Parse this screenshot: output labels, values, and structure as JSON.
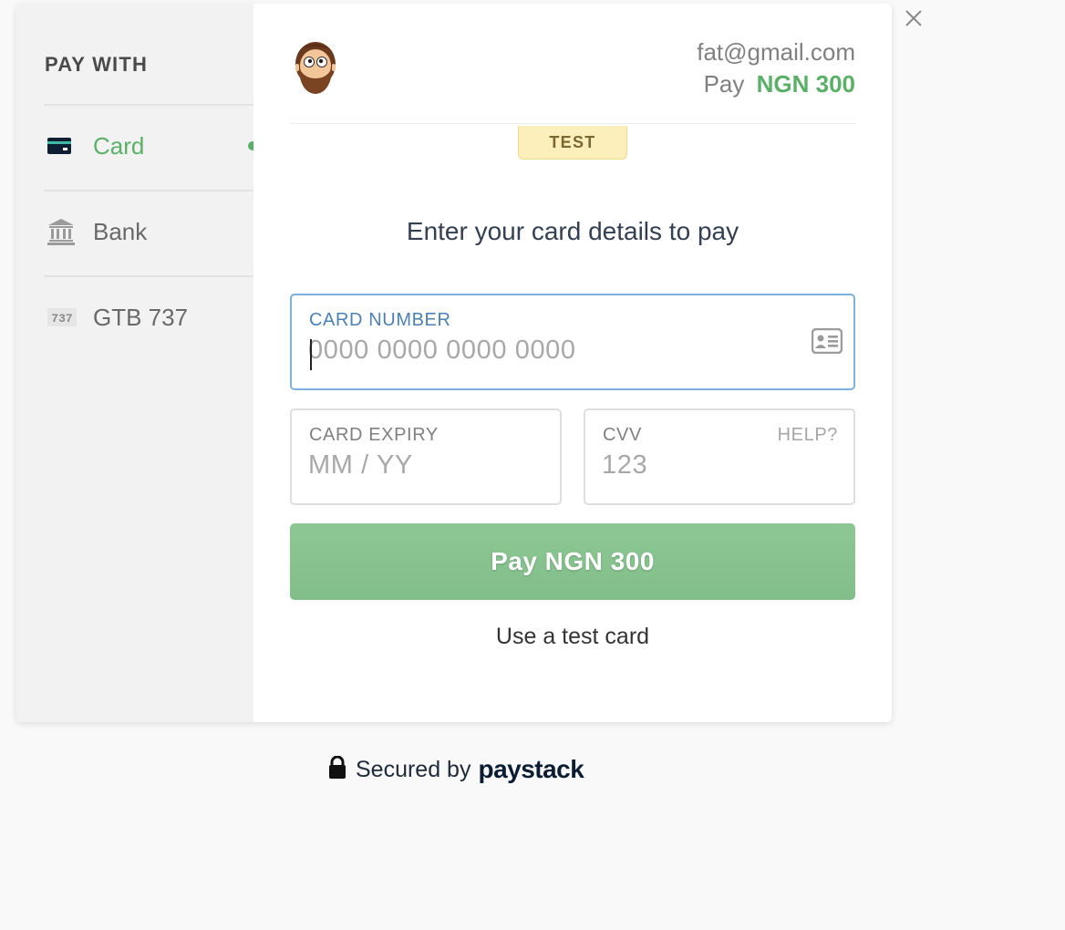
{
  "sidebar": {
    "title": "PAY WITH",
    "items": [
      {
        "label": "Card",
        "icon": "credit-card-icon",
        "active": true
      },
      {
        "label": "Bank",
        "icon": "bank-icon",
        "active": false
      },
      {
        "label": "GTB 737",
        "icon": "ussd-737-icon",
        "active": false,
        "icon_text": "737"
      }
    ]
  },
  "header": {
    "email": "fat@gmail.com",
    "pay_prefix": "Pay",
    "amount": "NGN 300",
    "badge": "TEST"
  },
  "form": {
    "heading": "Enter your card details to pay",
    "card_number": {
      "label": "CARD NUMBER",
      "placeholder": "0000 0000 0000 0000",
      "value": ""
    },
    "card_expiry": {
      "label": "CARD EXPIRY",
      "placeholder": "MM / YY",
      "value": ""
    },
    "cvv": {
      "label": "CVV",
      "placeholder": "123",
      "value": "",
      "help": "HELP?"
    },
    "pay_button": "Pay NGN 300",
    "test_card_link": "Use a test card"
  },
  "footer": {
    "secured_text": "Secured by",
    "brand": "paystack"
  },
  "colors": {
    "accent_green": "#5ab067",
    "button_green": "#88c490",
    "focus_blue": "#7cb1dd",
    "badge_yellow": "#fdefbb"
  }
}
